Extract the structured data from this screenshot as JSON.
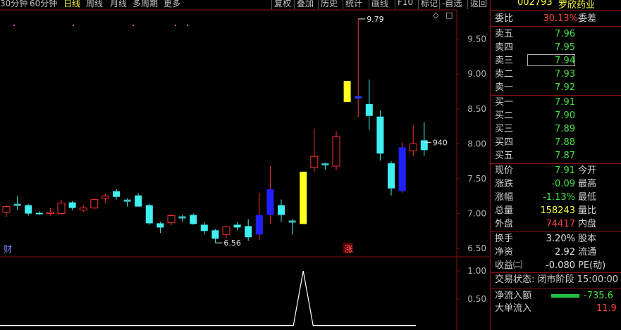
{
  "periods": [
    {
      "label": "30分钟",
      "active": false
    },
    {
      "label": "60分钟",
      "active": false
    },
    {
      "label": "日线",
      "active": true
    },
    {
      "label": "周线",
      "active": false
    },
    {
      "label": "月线",
      "active": false
    },
    {
      "label": "多周期",
      "active": false
    },
    {
      "label": "更多",
      "active": false
    }
  ],
  "toolbar": {
    "buttons": [
      "复权",
      "叠加",
      "历史",
      "统计",
      "画线",
      "F10",
      "标记",
      "-自选",
      "返回"
    ]
  },
  "stock": {
    "code": "002793",
    "name": "罗欣药业"
  },
  "colors": {
    "up": "#ff3030",
    "down": "#40f0f0",
    "yellow": "#ffff20",
    "blue": "#2020ff",
    "accent_border": "#8a1010"
  },
  "chart_data": {
    "type": "candlestick",
    "ylim": [
      6.4,
      9.9
    ],
    "y_ticks": [
      "9.50",
      "9.00",
      "8.50",
      "8.00",
      "7.50",
      "7.00",
      "6.50"
    ],
    "indicator_ticks": [
      "1.00",
      "0.50"
    ],
    "candles": [
      {
        "o": 7.02,
        "h": 7.12,
        "l": 6.95,
        "c": 7.1,
        "color": "up"
      },
      {
        "o": 7.12,
        "h": 7.25,
        "l": 7.05,
        "c": 7.14,
        "color": "flat"
      },
      {
        "o": 7.12,
        "h": 7.14,
        "l": 6.97,
        "c": 7.0,
        "color": "down"
      },
      {
        "o": 7.0,
        "h": 7.03,
        "l": 6.98,
        "c": 7.01,
        "color": "down"
      },
      {
        "o": 7.0,
        "h": 7.08,
        "l": 6.97,
        "c": 7.02,
        "color": "up"
      },
      {
        "o": 7.0,
        "h": 7.2,
        "l": 6.98,
        "c": 7.15,
        "color": "up"
      },
      {
        "o": 7.16,
        "h": 7.18,
        "l": 7.05,
        "c": 7.08,
        "color": "down"
      },
      {
        "o": 7.05,
        "h": 7.12,
        "l": 7.02,
        "c": 7.08,
        "color": "up"
      },
      {
        "o": 7.08,
        "h": 7.22,
        "l": 7.06,
        "c": 7.2,
        "color": "up"
      },
      {
        "o": 7.22,
        "h": 7.28,
        "l": 7.15,
        "c": 7.25,
        "color": "up"
      },
      {
        "o": 7.32,
        "h": 7.35,
        "l": 7.2,
        "c": 7.24,
        "color": "down"
      },
      {
        "o": 7.2,
        "h": 7.22,
        "l": 7.1,
        "c": 7.18,
        "color": "flat"
      },
      {
        "o": 7.26,
        "h": 7.29,
        "l": 7.1,
        "c": 7.1,
        "color": "down"
      },
      {
        "o": 7.12,
        "h": 7.14,
        "l": 6.84,
        "c": 6.86,
        "color": "down"
      },
      {
        "o": 6.86,
        "h": 6.88,
        "l": 6.72,
        "c": 6.8,
        "color": "down"
      },
      {
        "o": 6.87,
        "h": 6.99,
        "l": 6.83,
        "c": 6.97,
        "color": "up"
      },
      {
        "o": 6.96,
        "h": 6.98,
        "l": 6.88,
        "c": 6.95,
        "color": "flat"
      },
      {
        "o": 6.98,
        "h": 7.0,
        "l": 6.84,
        "c": 6.85,
        "color": "down"
      },
      {
        "o": 6.84,
        "h": 6.88,
        "l": 6.7,
        "c": 6.75,
        "color": "down"
      },
      {
        "o": 6.76,
        "h": 6.78,
        "l": 6.58,
        "c": 6.64,
        "color": "down"
      },
      {
        "o": 6.7,
        "h": 6.82,
        "l": 6.65,
        "c": 6.81,
        "color": "up"
      },
      {
        "o": 6.84,
        "h": 6.88,
        "l": 6.76,
        "c": 6.8,
        "color": "down"
      },
      {
        "o": 6.82,
        "h": 6.92,
        "l": 6.61,
        "c": 6.66,
        "color": "down"
      },
      {
        "o": 6.7,
        "h": 7.3,
        "l": 6.62,
        "c": 6.98,
        "color": "blue"
      },
      {
        "o": 6.98,
        "h": 7.68,
        "l": 6.85,
        "c": 7.35,
        "color": "blue"
      },
      {
        "o": 7.12,
        "h": 7.2,
        "l": 6.88,
        "c": 6.98,
        "color": "down"
      },
      {
        "o": 6.88,
        "h": 6.92,
        "l": 6.7,
        "c": 6.9,
        "color": "flat"
      },
      {
        "o": 6.85,
        "h": 7.6,
        "l": 6.85,
        "c": 7.6,
        "color": "yellow"
      },
      {
        "o": 7.66,
        "h": 8.22,
        "l": 7.6,
        "c": 7.82,
        "color": "up"
      },
      {
        "o": 7.68,
        "h": 7.73,
        "l": 7.63,
        "c": 7.72,
        "color": "flat"
      },
      {
        "o": 7.68,
        "h": 8.18,
        "l": 7.62,
        "c": 8.1,
        "color": "up"
      },
      {
        "o": 8.6,
        "h": 8.9,
        "l": 8.6,
        "c": 8.9,
        "color": "yellow"
      },
      {
        "o": 8.67,
        "h": 9.79,
        "l": 8.38,
        "c": 8.68,
        "color": "flat"
      },
      {
        "o": 8.57,
        "h": 8.92,
        "l": 8.2,
        "c": 8.4,
        "color": "down"
      },
      {
        "o": 8.39,
        "h": 8.48,
        "l": 7.76,
        "c": 7.86,
        "color": "down"
      },
      {
        "o": 7.72,
        "h": 7.75,
        "l": 7.26,
        "c": 7.36,
        "color": "down"
      },
      {
        "o": 7.32,
        "h": 8.02,
        "l": 7.3,
        "c": 7.95,
        "color": "blue"
      },
      {
        "o": 7.9,
        "h": 8.27,
        "l": 7.82,
        "c": 8.0,
        "color": "up"
      },
      {
        "o": 8.05,
        "h": 8.31,
        "l": 7.83,
        "c": 7.91,
        "color": "down"
      }
    ],
    "annotations": [
      {
        "text": "9.79",
        "price": 9.79,
        "candle": 32
      },
      {
        "text": "6.56",
        "price": 6.58,
        "candle": 19
      },
      {
        "text": "940",
        "price": 8.02,
        "candle": 38
      }
    ],
    "markers": [
      {
        "text": "财",
        "candle": 0
      },
      {
        "text": "涨",
        "candle": 31
      }
    ],
    "indicator": {
      "peak_candle": 27,
      "peak_value": 1.0
    }
  },
  "quote": {
    "weibi": {
      "label": "委比",
      "value": "30.13%",
      "label2": "委差"
    },
    "asks": [
      {
        "label": "卖五",
        "price": "7.96"
      },
      {
        "label": "卖四",
        "price": "7.95"
      },
      {
        "label": "卖三",
        "price": "7.94"
      },
      {
        "label": "卖二",
        "price": "7.93"
      },
      {
        "label": "卖一",
        "price": "7.92"
      }
    ],
    "bids": [
      {
        "label": "买一",
        "price": "7.91"
      },
      {
        "label": "买二",
        "price": "7.90"
      },
      {
        "label": "买三",
        "price": "7.89"
      },
      {
        "label": "买四",
        "price": "7.88"
      },
      {
        "label": "买五",
        "price": "7.87"
      }
    ],
    "stats": [
      {
        "label": "现价",
        "value": "7.91",
        "label2": "今开",
        "color": "green"
      },
      {
        "label": "涨跌",
        "value": "-0.09",
        "label2": "最高",
        "color": "green"
      },
      {
        "label": "涨幅",
        "value": "-1.13%",
        "label2": "最低",
        "color": "green"
      },
      {
        "label": "总量",
        "value": "158243",
        "label2": "量比",
        "color": "yellow"
      },
      {
        "label": "外盘",
        "value": "74417",
        "label2": "内盘",
        "color": "red"
      }
    ],
    "stats2": [
      {
        "label": "换手",
        "value": "3.20%",
        "label2": "股本",
        "color": "white"
      },
      {
        "label": "净资",
        "value": "2.92",
        "label2": "流通",
        "color": "white"
      },
      {
        "label": "收益㈡",
        "value": "-0.080",
        "label2": "PE(动)",
        "color": "white"
      }
    ],
    "trade_status": "交易状态: 闭市阶段 15:00:00",
    "netflow": {
      "label": "净流入额",
      "value": "-735.6"
    },
    "netflow2": {
      "label": "大单流入",
      "value": "11.9"
    }
  }
}
